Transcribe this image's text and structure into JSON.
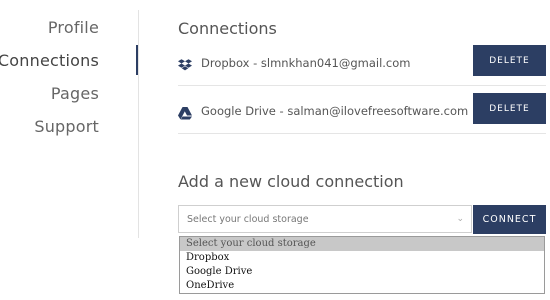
{
  "sidebar": {
    "items": [
      {
        "label": "Profile",
        "active": false
      },
      {
        "label": "Connections",
        "active": true
      },
      {
        "label": "Pages",
        "active": false
      },
      {
        "label": "Support",
        "active": false
      }
    ]
  },
  "connections": {
    "title": "Connections",
    "items": [
      {
        "service": "dropbox",
        "icon": "dropbox-icon",
        "label": "Dropbox - slmnkhan041@gmail.com",
        "action": "DELETE"
      },
      {
        "service": "google-drive",
        "icon": "google-drive-icon",
        "label": "Google Drive - salman@ilovefreesoftware.com",
        "action": "DELETE"
      }
    ]
  },
  "add_connection": {
    "title": "Add a new cloud connection",
    "select": {
      "value": "Select your cloud storage",
      "options": [
        "Select your cloud storage",
        "Dropbox",
        "Google Drive",
        "OneDrive"
      ],
      "selected_index": 0
    },
    "connect_label": "CONNECT"
  },
  "colors": {
    "accent": "#2c3e63",
    "divider": "#e3e3e3"
  }
}
